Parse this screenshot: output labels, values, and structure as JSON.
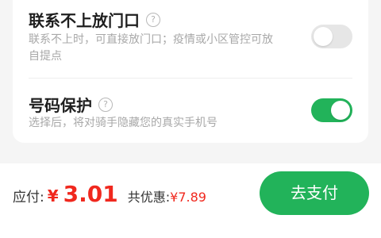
{
  "settings": {
    "items": [
      {
        "title": "联系不上放门口",
        "help_icon": "question-circle-icon",
        "description": "联系不上时，可直接放门口；疫情或小区管控可放自提点",
        "toggle_on": false
      },
      {
        "title": "号码保护",
        "help_icon": "question-circle-icon",
        "description": "选择后，将对骑手隐藏您的真实手机号",
        "toggle_on": true
      }
    ],
    "help_glyph": "?"
  },
  "footer": {
    "pay_label": "应付:",
    "currency": "¥",
    "amount": "3.01",
    "discount_label": "共优惠:",
    "discount_value": "¥7.89",
    "pay_button_label": "去支付"
  },
  "colors": {
    "accent_green": "#22b35a",
    "price_red": "#f0281e",
    "toggle_off": "#e6e6e6"
  }
}
